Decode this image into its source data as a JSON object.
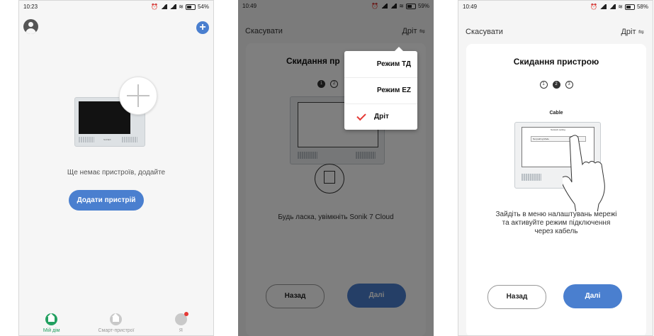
{
  "screen1": {
    "status": {
      "time": "10:23",
      "battery": "54%"
    },
    "empty_text": "Ще немає пристроїв, додайте",
    "add_button": "Додати пристрій",
    "monitor_logo": "SLINEX",
    "tabs": [
      {
        "label": "Мій дім",
        "icon": "home-icon",
        "active": true,
        "color": "#22a060"
      },
      {
        "label": "Смарт-пристрої",
        "icon": "smart-device-icon",
        "active": false,
        "color": "#c9c9c9"
      },
      {
        "label": "Я",
        "icon": "profile-icon",
        "active": false,
        "color": "#c9c9c9"
      }
    ]
  },
  "screen2": {
    "status": {
      "time": "10:49",
      "battery": "59%"
    },
    "cancel": "Скасувати",
    "mode": "Дріт",
    "card_title": "Скидання пр",
    "steps": [
      "1",
      "2"
    ],
    "instruction": "Будь ласка, увімкніть Sonik 7 Cloud",
    "back": "Назад",
    "next": "Далі",
    "menu": {
      "items": [
        "Режим ТД",
        "Режим EZ",
        "Дріт"
      ],
      "selected": "Дріт"
    }
  },
  "screen3": {
    "status": {
      "time": "10:49",
      "battery": "58%"
    },
    "cancel": "Скасувати",
    "mode": "Дріт",
    "card_title": "Скидання пристрою",
    "steps": [
      "1",
      "2",
      "3"
    ],
    "image_label": "Cable",
    "screen_title": "Network setting",
    "screen_row_label": "Net pairing Mode",
    "screen_row_value": "Cable",
    "instruction_lines": [
      "Зайдіть в меню налаштувань мережі",
      "та активуйте режим підключення",
      "через кабель"
    ],
    "back": "Назад",
    "next": "Далі"
  },
  "colors": {
    "accent": "#4a7fcf",
    "active_tab": "#22a060",
    "check": "#e53935"
  }
}
